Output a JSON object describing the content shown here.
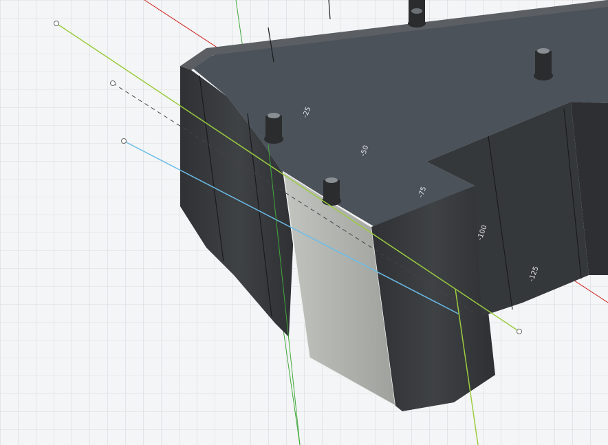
{
  "viewport": {
    "background": "#f4f5f6",
    "grid_color": "#c9ccd0",
    "model_dark": "#3b3d40",
    "model_light": "#a9aba7",
    "floor_color": "#4a5159",
    "axis_colors": {
      "x": "#d02020",
      "y": "#41a83c",
      "sketch_green": "#9ccc40",
      "sketch_blue": "#6bbde8"
    }
  },
  "dimension_labels": [
    "-25",
    "-50",
    "-75",
    "-100",
    "-125"
  ]
}
